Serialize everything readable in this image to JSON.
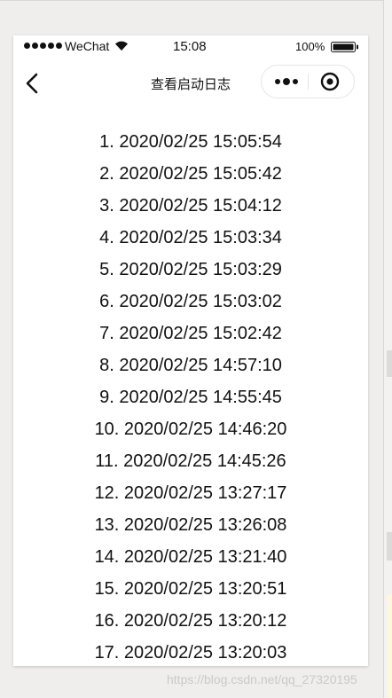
{
  "status_bar": {
    "carrier": "WeChat",
    "time": "15:08",
    "battery": "100%",
    "icons": [
      "signal-dots-icon",
      "wifi-icon",
      "battery-icon"
    ]
  },
  "nav": {
    "title": "查看启动日志",
    "back_icon": "chevron-left-icon",
    "more_icon": "more-dots-icon",
    "close_icon": "target-circle-icon"
  },
  "logs": [
    "1. 2020/02/25 15:05:54",
    "2. 2020/02/25 15:05:42",
    "3. 2020/02/25 15:04:12",
    "4. 2020/02/25 15:03:34",
    "5. 2020/02/25 15:03:29",
    "6. 2020/02/25 15:03:02",
    "7. 2020/02/25 15:02:42",
    "8. 2020/02/25 14:57:10",
    "9. 2020/02/25 14:55:45",
    "10. 2020/02/25 14:46:20",
    "11. 2020/02/25 14:45:26",
    "12. 2020/02/25 13:27:17",
    "13. 2020/02/25 13:26:08",
    "14. 2020/02/25 13:21:40",
    "15. 2020/02/25 13:20:51",
    "16. 2020/02/25 13:20:12",
    "17. 2020/02/25 13:20:03"
  ],
  "watermark": "https://blog.csdn.net/qq_27320195",
  "colors": {
    "background": "#efeeec",
    "page": "#ffffff",
    "text": "#111111",
    "watermark": "#c9c9c9"
  }
}
